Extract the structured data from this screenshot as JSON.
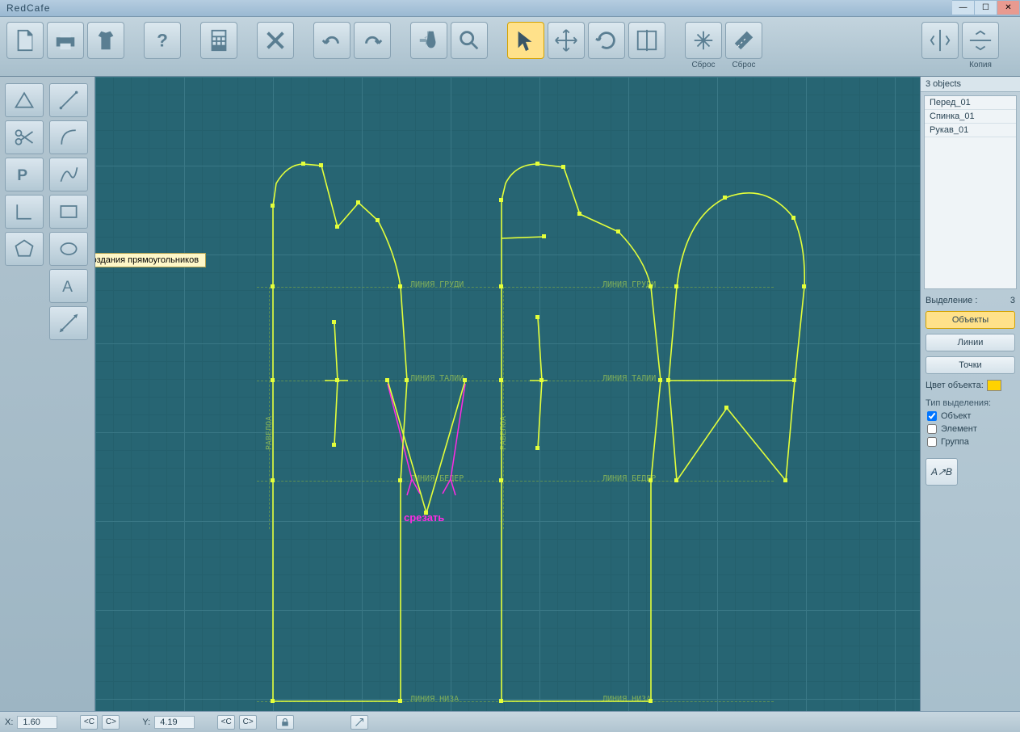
{
  "title": "RedCafe",
  "toolbar": {
    "reset1": "Сброс",
    "reset2": "Сброс",
    "copy": "Копия"
  },
  "tooltip": "Режим создания прямоугольников",
  "canvas_text": {
    "chest1": "ЛИНИЯ  ГРУДИ",
    "chest2": "ЛИНИЯ  ГРУДИ",
    "waist1": "ЛИНИЯ  ТАЛИИ",
    "waist2": "ЛИНИЯ  ТАЛИИ",
    "hip1": "ЛИНИЯ  БЕДЕР",
    "hip2": "ЛИНИЯ  БЕДЕР",
    "hem1": "ЛИНИЯ  НИЗА",
    "hem2": "ЛИНИЯ  НИЗА",
    "balance1": "РАВЕЛОА",
    "balance2": "РАВЕЛОА",
    "cut": "срезать"
  },
  "right": {
    "objects_count": "3 objects",
    "list": [
      "Перед_01",
      "Спинка_01",
      "Рукав_01"
    ],
    "sel_label": "Выделение :",
    "sel_count": "3",
    "btn_objects": "Объекты",
    "btn_lines": "Линии",
    "btn_points": "Точки",
    "color_label": "Цвет объекта:",
    "seltype_label": "Тип выделения:",
    "chk_object": "Объект",
    "chk_element": "Элемент",
    "chk_group": "Группа",
    "ab": "A↗B"
  },
  "status": {
    "x_label": "X:",
    "x_val": "1.60",
    "y_label": "Y:",
    "y_val": "4.19",
    "c1": "<C",
    "c2": "C>",
    "c3": "<C",
    "c4": "C>"
  }
}
